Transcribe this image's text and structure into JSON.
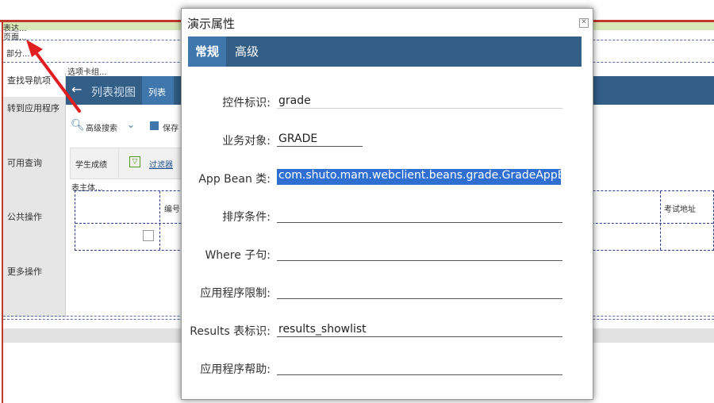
{
  "background": {
    "labels": {
      "expression": "表达...",
      "page": "页面...",
      "section": "部分...",
      "tab_group": "选项卡组...",
      "table_body": "表主体..."
    },
    "left_nav": [
      {
        "label": "查找导航项",
        "active": true
      },
      {
        "label": "转到应用程序",
        "active": false
      },
      {
        "label": "可用查询",
        "active": false
      },
      {
        "label": "公共操作",
        "active": false
      },
      {
        "label": "更多操作",
        "active": false
      }
    ],
    "list_view": {
      "back_icon": "arrow-left-icon",
      "label": "列表视图"
    },
    "tab_list": "列表",
    "toolbar": {
      "advanced_search": "高级搜索",
      "save": "保存"
    },
    "filter": {
      "table_name": "学生成绩",
      "filter_label": "过滤器"
    },
    "grid_headers": {
      "id": "编号",
      "exam_address": "考试地址"
    }
  },
  "dialog": {
    "title": "演示属性",
    "close_icon": "close-icon",
    "tabs": [
      {
        "label": "常规",
        "active": true
      },
      {
        "label": "高级",
        "active": false
      }
    ],
    "fields": {
      "control_id": {
        "label": "控件标识:",
        "value": "grade"
      },
      "business_object": {
        "label": "业务对象:",
        "value": "GRADE"
      },
      "app_bean": {
        "label": "App Bean 类:",
        "value": "com.shuto.mam.webclient.beans.grade.GradeAppBean"
      },
      "order_by": {
        "label": "排序条件:",
        "value": ""
      },
      "where_clause": {
        "label": "Where 子句:",
        "value": ""
      },
      "app_restriction": {
        "label": "应用程序限制:",
        "value": ""
      },
      "results_table_id": {
        "label": "Results 表标识:",
        "value": "results_showlist"
      },
      "app_help": {
        "label": "应用程序帮助:",
        "value": ""
      }
    }
  },
  "colors": {
    "accent": "#335e86",
    "accent_active": "#3f77ad",
    "arrow": "#e02020",
    "selection": "#2f6fd1"
  }
}
